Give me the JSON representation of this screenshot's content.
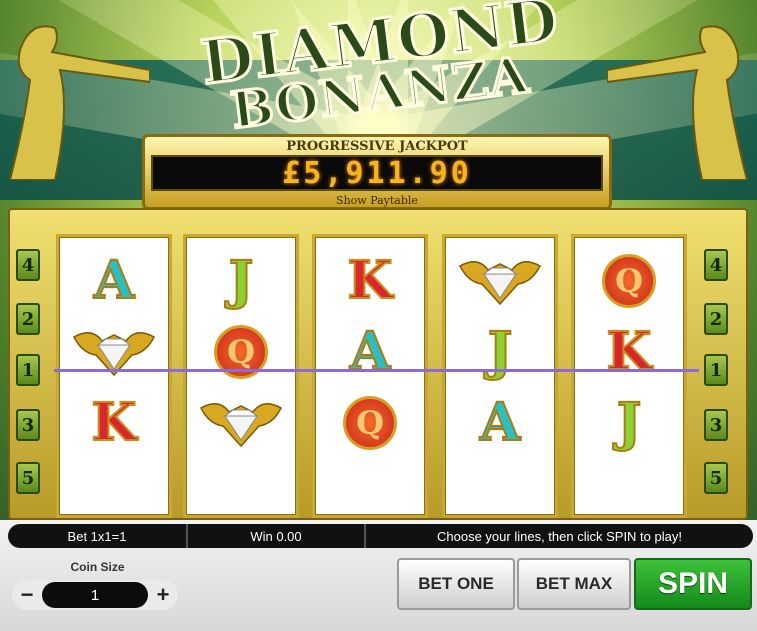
{
  "game": {
    "title_line1": "DIAMOND",
    "title_line2": "BONANZA"
  },
  "jackpot": {
    "label": "PROGRESSIVE JACKPOT",
    "value": "£5,911.90",
    "paytable_link": "Show Paytable"
  },
  "reels": [
    [
      "A",
      "diamond",
      "K",
      "",
      ""
    ],
    [
      "J",
      "Q",
      "diamond",
      "",
      ""
    ],
    [
      "K",
      "A",
      "Q",
      "",
      ""
    ],
    [
      "diamond",
      "J",
      "A",
      "",
      ""
    ],
    [
      "Q",
      "K",
      "J",
      "",
      ""
    ]
  ],
  "line_markers": {
    "left": [
      "4",
      "2",
      "1",
      "3",
      "5"
    ],
    "right": [
      "4",
      "2",
      "1",
      "3",
      "5"
    ]
  },
  "status": {
    "bet": "Bet 1x1=1",
    "win": "Win 0.00",
    "message": "Choose your lines, then click SPIN to play!"
  },
  "controls": {
    "coin_size_label": "Coin Size",
    "coin_size_value": "1",
    "minus": "−",
    "plus": "+",
    "bet_one": "BET ONE",
    "bet_max": "BET MAX",
    "spin": "SPIN"
  },
  "colors": {
    "payline": "#8c6ad8",
    "spin_button": "#2aa82a",
    "jackpot_digits": "#f5b522"
  }
}
